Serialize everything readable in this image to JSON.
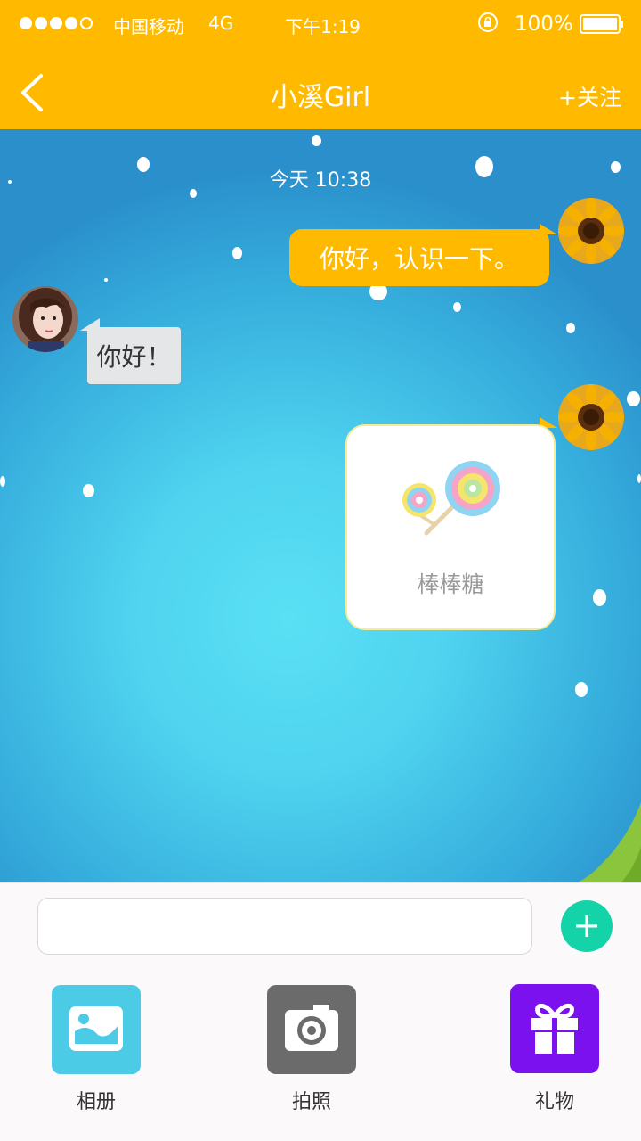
{
  "status_bar": {
    "carrier": "中国移动",
    "network": "4G",
    "time": "下午1:19",
    "battery": "100%",
    "signal_icon": "signal-dots-icon",
    "rotation_lock_icon": "rotation-lock-icon",
    "battery_icon": "battery-icon"
  },
  "header": {
    "title": "小溪Girl",
    "follow_label": "+关注",
    "back_icon": "chevron-left-icon",
    "color": "#ffba00"
  },
  "chat": {
    "timestamp": "今天 10:38",
    "messages": [
      {
        "sender": "me",
        "type": "text",
        "text": "你好，认识一下。"
      },
      {
        "sender": "her",
        "type": "text",
        "text": "你好！"
      },
      {
        "sender": "me",
        "type": "gift",
        "gift_name": "棒棒糖",
        "gift_icon": "lollipop-icon"
      }
    ]
  },
  "composer": {
    "input_value": "",
    "plus_icon": "plus-icon",
    "accent": "#15d3a8"
  },
  "tools": [
    {
      "label": "相册",
      "icon": "image-icon",
      "color": "#4ccbe7"
    },
    {
      "label": "拍照",
      "icon": "camera-icon",
      "color": "#6b6b6b"
    },
    {
      "label": "礼物",
      "icon": "gift-icon",
      "color": "#7a11ee"
    }
  ]
}
